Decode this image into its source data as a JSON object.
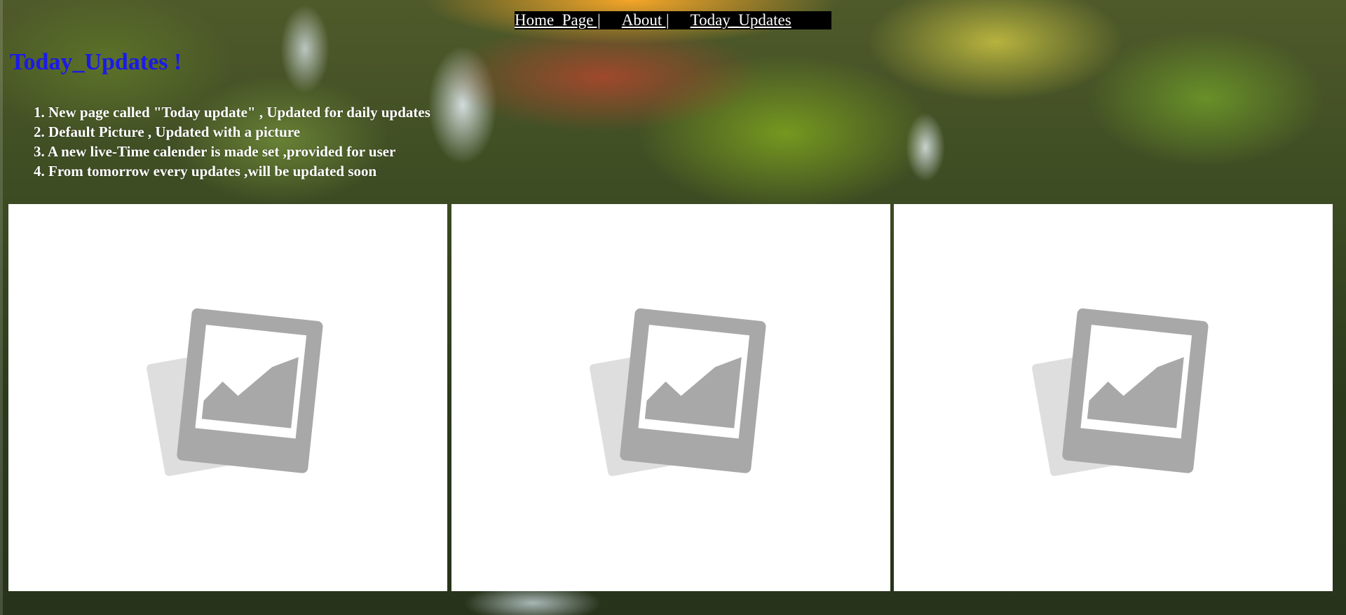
{
  "nav": {
    "items": [
      {
        "label": "Home_Page |",
        "id": "home"
      },
      {
        "label": "About |",
        "id": "about"
      },
      {
        "label": "Today_Updates",
        "id": "today"
      }
    ]
  },
  "main": {
    "title": "Today_Updates !",
    "updates": [
      "1. New page called \"Today update\" , Updated for daily updates",
      "2. Default Picture , Updated with a picture",
      "3. A new live-Time calender is made set ,provided for user",
      "4. From tomorrow every updates ,will be updated soon"
    ]
  },
  "gallery": {
    "cards": [
      {
        "icon": "image-placeholder-icon"
      },
      {
        "icon": "image-placeholder-icon"
      },
      {
        "icon": "image-placeholder-icon"
      }
    ]
  },
  "colors": {
    "title": "#1a1ae8",
    "nav_background": "#000000",
    "nav_text": "#ffffff",
    "list_text": "#ffffff",
    "card_background": "#ffffff",
    "icon_gray": "#a6a6a6"
  }
}
